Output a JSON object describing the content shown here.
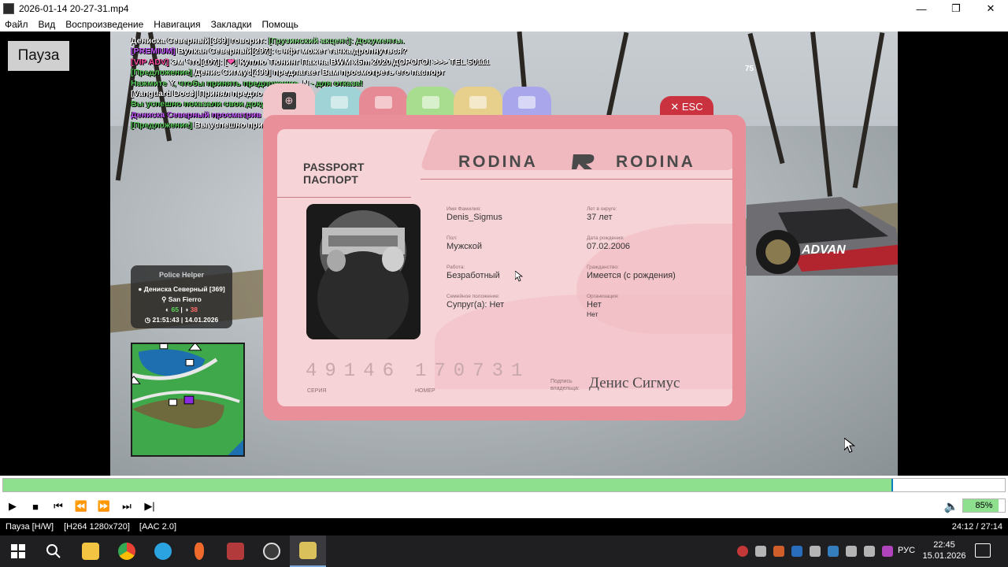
{
  "window": {
    "title": "2026-01-14 20-27-31.mp4",
    "minimize": "—",
    "restore": "❐",
    "close": "✕"
  },
  "menu": [
    "Файл",
    "Вид",
    "Воспроизведение",
    "Навигация",
    "Закладки",
    "Помощь"
  ],
  "overlay": {
    "pause_label": "Пауза"
  },
  "game": {
    "fps": "75",
    "chat": [
      {
        "parts": [
          {
            "text": "Дениска Северный[369] говорит: ",
            "color": "white"
          },
          {
            "text": "[Грузинский акцент]: Документы.",
            "color": "lightgreen"
          }
        ]
      },
      {
        "parts": [
          {
            "text": "[PREMIUM] ",
            "color": "purple"
          },
          {
            "text": "Вулкан Северный[297]: с нфт может тачка дропнуться?",
            "color": "white"
          }
        ]
      },
      {
        "parts": [
          {
            "text": "[VIP ADV] ",
            "color": "pink"
          },
          {
            "text": "Эм Что[107]: [",
            "color": "white"
          },
          {
            "text": "❤",
            "color": "pink"
          },
          {
            "text": "] Куплю Тюнинг Пак на BWM x5m 2020 ДОРОГО! >>> TEL 50111",
            "color": "white"
          }
        ]
      },
      {
        "parts": [
          {
            "text": "[Предложение] ",
            "color": "green"
          },
          {
            "text": "Денис Сигмус[499] предлагает Вам просмотреть его паспорт",
            "color": "white"
          }
        ]
      },
      {
        "parts": [
          {
            "text": "Нажмите ",
            "color": "green"
          },
          {
            "text": "Y",
            "color": "white"
          },
          {
            "text": ", чтобы принять предложение, ",
            "color": "green"
          },
          {
            "text": "N",
            "color": "white"
          },
          {
            "text": " - для отказа!",
            "color": "green"
          }
        ]
      },
      {
        "parts": [
          {
            "text": "[Vanguard Docs] Принял предло",
            "color": "white"
          }
        ]
      },
      {
        "parts": [
          {
            "text": "Вы успешно показали свои доку",
            "color": "green"
          }
        ]
      },
      {
        "parts": [
          {
            "text": "Дениска Северный просматрив",
            "color": "purple"
          }
        ]
      },
      {
        "parts": [
          {
            "text": "[Предложение] ",
            "color": "green"
          },
          {
            "text": "Вы успешно при",
            "color": "white"
          }
        ]
      }
    ],
    "helper": {
      "title": "Police Helper",
      "name": "Дениска Северный [369]",
      "city": "San Fierro",
      "stat1": "65",
      "stat2": "38",
      "datetime": "21:51:43 | 14.01.2026"
    }
  },
  "passport": {
    "esc_label": "✕ ESC",
    "title_en": "PASSPORT",
    "title_ru": "ПАСПОРТ",
    "brand_left": "RODINA",
    "brand_right": "RODINA",
    "fields": {
      "name": {
        "label": "Имя Фамилия:",
        "value": "Denis_Sigmus"
      },
      "gender": {
        "label": "Пол:",
        "value": "Мужской"
      },
      "job": {
        "label": "Работа:",
        "value": "Безработный"
      },
      "marital": {
        "label": "Семейное положение:",
        "value": "Супруг(а): Нет"
      },
      "years": {
        "label": "Лет в округе:",
        "value": "37 лет"
      },
      "birth": {
        "label": "Дата рождения:",
        "value": "07.02.2006"
      },
      "citizenship": {
        "label": "Гражданство:",
        "value": "Имеется (с рождения)"
      },
      "org": {
        "label": "Организация:",
        "value": "Нет",
        "value2": "Нет"
      }
    },
    "series": "49146",
    "series_label": "СЕРИЯ",
    "number": "170731",
    "number_label": "НОМЕР",
    "sign_label_1": "Подпись",
    "sign_label_2": "владельца:",
    "signature": "Денис Сигмус"
  },
  "player": {
    "progress_fraction": 0.888,
    "volume_label": "85%",
    "volume_fraction": 0.85
  },
  "status": {
    "state": "Пауза [H/W]",
    "video": "[H264 1280x720]",
    "audio": "[AAC 2.0]",
    "time": "24:12 / 27:14"
  },
  "taskbar": {
    "lang": "РУС",
    "time": "22:45",
    "date": "15.01.2026",
    "apps": [
      "start-icon",
      "search-icon",
      "file-explorer-icon",
      "chrome-icon",
      "telegram-icon",
      "microphone-app-icon",
      "game-app-icon",
      "obs-icon",
      "media-player-icon"
    ]
  }
}
